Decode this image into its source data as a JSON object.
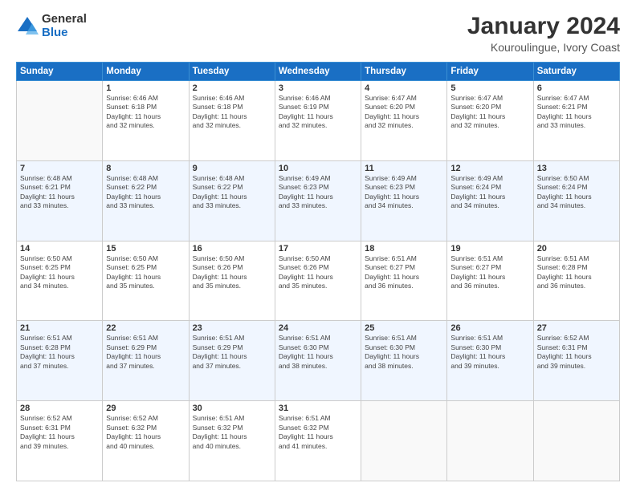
{
  "logo": {
    "general": "General",
    "blue": "Blue"
  },
  "title": "January 2024",
  "subtitle": "Kouroulingue, Ivory Coast",
  "days": [
    "Sunday",
    "Monday",
    "Tuesday",
    "Wednesday",
    "Thursday",
    "Friday",
    "Saturday"
  ],
  "weeks": [
    [
      {
        "num": "",
        "info": ""
      },
      {
        "num": "1",
        "info": "Sunrise: 6:46 AM\nSunset: 6:18 PM\nDaylight: 11 hours\nand 32 minutes."
      },
      {
        "num": "2",
        "info": "Sunrise: 6:46 AM\nSunset: 6:18 PM\nDaylight: 11 hours\nand 32 minutes."
      },
      {
        "num": "3",
        "info": "Sunrise: 6:46 AM\nSunset: 6:19 PM\nDaylight: 11 hours\nand 32 minutes."
      },
      {
        "num": "4",
        "info": "Sunrise: 6:47 AM\nSunset: 6:20 PM\nDaylight: 11 hours\nand 32 minutes."
      },
      {
        "num": "5",
        "info": "Sunrise: 6:47 AM\nSunset: 6:20 PM\nDaylight: 11 hours\nand 32 minutes."
      },
      {
        "num": "6",
        "info": "Sunrise: 6:47 AM\nSunset: 6:21 PM\nDaylight: 11 hours\nand 33 minutes."
      }
    ],
    [
      {
        "num": "7",
        "info": "Sunrise: 6:48 AM\nSunset: 6:21 PM\nDaylight: 11 hours\nand 33 minutes."
      },
      {
        "num": "8",
        "info": "Sunrise: 6:48 AM\nSunset: 6:22 PM\nDaylight: 11 hours\nand 33 minutes."
      },
      {
        "num": "9",
        "info": "Sunrise: 6:48 AM\nSunset: 6:22 PM\nDaylight: 11 hours\nand 33 minutes."
      },
      {
        "num": "10",
        "info": "Sunrise: 6:49 AM\nSunset: 6:23 PM\nDaylight: 11 hours\nand 33 minutes."
      },
      {
        "num": "11",
        "info": "Sunrise: 6:49 AM\nSunset: 6:23 PM\nDaylight: 11 hours\nand 34 minutes."
      },
      {
        "num": "12",
        "info": "Sunrise: 6:49 AM\nSunset: 6:24 PM\nDaylight: 11 hours\nand 34 minutes."
      },
      {
        "num": "13",
        "info": "Sunrise: 6:50 AM\nSunset: 6:24 PM\nDaylight: 11 hours\nand 34 minutes."
      }
    ],
    [
      {
        "num": "14",
        "info": "Sunrise: 6:50 AM\nSunset: 6:25 PM\nDaylight: 11 hours\nand 34 minutes."
      },
      {
        "num": "15",
        "info": "Sunrise: 6:50 AM\nSunset: 6:25 PM\nDaylight: 11 hours\nand 35 minutes."
      },
      {
        "num": "16",
        "info": "Sunrise: 6:50 AM\nSunset: 6:26 PM\nDaylight: 11 hours\nand 35 minutes."
      },
      {
        "num": "17",
        "info": "Sunrise: 6:50 AM\nSunset: 6:26 PM\nDaylight: 11 hours\nand 35 minutes."
      },
      {
        "num": "18",
        "info": "Sunrise: 6:51 AM\nSunset: 6:27 PM\nDaylight: 11 hours\nand 36 minutes."
      },
      {
        "num": "19",
        "info": "Sunrise: 6:51 AM\nSunset: 6:27 PM\nDaylight: 11 hours\nand 36 minutes."
      },
      {
        "num": "20",
        "info": "Sunrise: 6:51 AM\nSunset: 6:28 PM\nDaylight: 11 hours\nand 36 minutes."
      }
    ],
    [
      {
        "num": "21",
        "info": "Sunrise: 6:51 AM\nSunset: 6:28 PM\nDaylight: 11 hours\nand 37 minutes."
      },
      {
        "num": "22",
        "info": "Sunrise: 6:51 AM\nSunset: 6:29 PM\nDaylight: 11 hours\nand 37 minutes."
      },
      {
        "num": "23",
        "info": "Sunrise: 6:51 AM\nSunset: 6:29 PM\nDaylight: 11 hours\nand 37 minutes."
      },
      {
        "num": "24",
        "info": "Sunrise: 6:51 AM\nSunset: 6:30 PM\nDaylight: 11 hours\nand 38 minutes."
      },
      {
        "num": "25",
        "info": "Sunrise: 6:51 AM\nSunset: 6:30 PM\nDaylight: 11 hours\nand 38 minutes."
      },
      {
        "num": "26",
        "info": "Sunrise: 6:51 AM\nSunset: 6:30 PM\nDaylight: 11 hours\nand 39 minutes."
      },
      {
        "num": "27",
        "info": "Sunrise: 6:52 AM\nSunset: 6:31 PM\nDaylight: 11 hours\nand 39 minutes."
      }
    ],
    [
      {
        "num": "28",
        "info": "Sunrise: 6:52 AM\nSunset: 6:31 PM\nDaylight: 11 hours\nand 39 minutes."
      },
      {
        "num": "29",
        "info": "Sunrise: 6:52 AM\nSunset: 6:32 PM\nDaylight: 11 hours\nand 40 minutes."
      },
      {
        "num": "30",
        "info": "Sunrise: 6:51 AM\nSunset: 6:32 PM\nDaylight: 11 hours\nand 40 minutes."
      },
      {
        "num": "31",
        "info": "Sunrise: 6:51 AM\nSunset: 6:32 PM\nDaylight: 11 hours\nand 41 minutes."
      },
      {
        "num": "",
        "info": ""
      },
      {
        "num": "",
        "info": ""
      },
      {
        "num": "",
        "info": ""
      }
    ]
  ]
}
